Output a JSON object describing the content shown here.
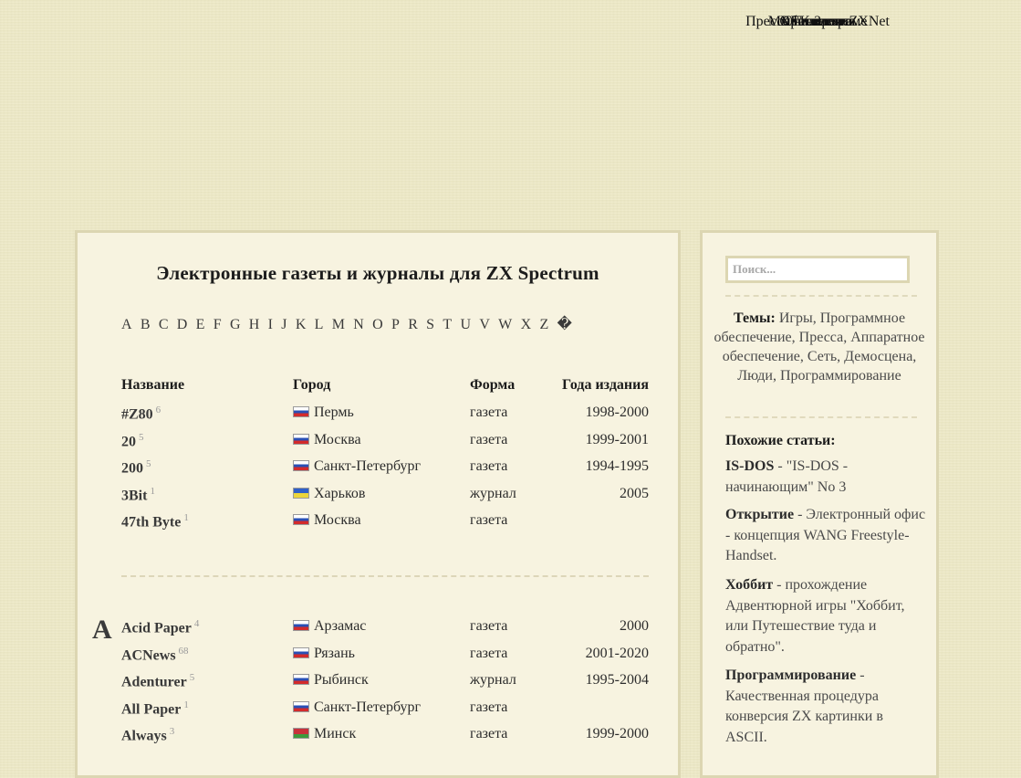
{
  "nav": {
    "row1": [
      "Пресса",
      "Книги",
      "ZXNet"
    ],
    "separator": "▪",
    "links": [
      "Мы в телеграме",
      "Обновления",
      "Галерея",
      "Хронология",
      "Статистика",
      "Гостевая",
      "?"
    ]
  },
  "main": {
    "title": "Электронные газеты и журналы для ZX Spectrum",
    "alphabet": [
      "A",
      "B",
      "C",
      "D",
      "E",
      "F",
      "G",
      "H",
      "I",
      "J",
      "K",
      "L",
      "M",
      "N",
      "O",
      "P",
      "R",
      "S",
      "T",
      "U",
      "V",
      "W",
      "X",
      "Z",
      "�"
    ],
    "headers": {
      "name": "Название",
      "city": "Город",
      "form": "Форма",
      "years": "Года издания"
    },
    "section_letter": "A",
    "rows_digits": [
      {
        "name": "#Z80",
        "count": "6",
        "flag": "ru",
        "city": "Пермь",
        "form": "газета",
        "years": "1998-2000"
      },
      {
        "name": "20",
        "count": "5",
        "flag": "ru",
        "city": "Москва",
        "form": "газета",
        "years": "1999-2001"
      },
      {
        "name": "200",
        "count": "5",
        "flag": "ru",
        "city": "Санкт-Петербург",
        "form": "газета",
        "years": "1994-1995"
      },
      {
        "name": "3Bit",
        "count": "1",
        "flag": "ua",
        "city": "Харьков",
        "form": "журнал",
        "years": "2005"
      },
      {
        "name": "47th Byte",
        "count": "1",
        "flag": "ru",
        "city": "Москва",
        "form": "газета",
        "years": ""
      }
    ],
    "rows_a": [
      {
        "name": "Acid Paper",
        "count": "4",
        "flag": "ru",
        "city": "Арзамас",
        "form": "газета",
        "years": "2000"
      },
      {
        "name": "ACNews",
        "count": "68",
        "flag": "ru",
        "city": "Рязань",
        "form": "газета",
        "years": "2001-2020"
      },
      {
        "name": "Adenturer",
        "count": "5",
        "flag": "ru",
        "city": "Рыбинск",
        "form": "журнал",
        "years": "1995-2004"
      },
      {
        "name": "All Paper",
        "count": "1",
        "flag": "ru",
        "city": "Санкт-Петербург",
        "form": "газета",
        "years": ""
      },
      {
        "name": "Always",
        "count": "3",
        "flag": "by",
        "city": "Минск",
        "form": "газета",
        "years": "1999-2000"
      }
    ]
  },
  "sidebar": {
    "search_placeholder": "Поиск...",
    "themes_label": "Темы:",
    "themes_text": "Игры, Программное обеспечение, Пресса, Аппаратное обеспечение, Сеть, Демосцена, Люди, Программирование",
    "similar_label": "Похожие статьи:",
    "similar": [
      {
        "title": "IS-DOS",
        "desc": " - \"IS-DOS - начинающим\" No 3"
      },
      {
        "title": "Открытие",
        "desc": " - Электронный офис - концепция WANG Freestyle-Handset."
      },
      {
        "title": "Хоббит",
        "desc": " - прохождение Адвентюрной игры \"Хоббит, или Путешествие туда и обратно\"."
      },
      {
        "title": "Программирование",
        "desc": " - Качественная процедура конверсия ZX картинки в ASCII."
      }
    ]
  }
}
